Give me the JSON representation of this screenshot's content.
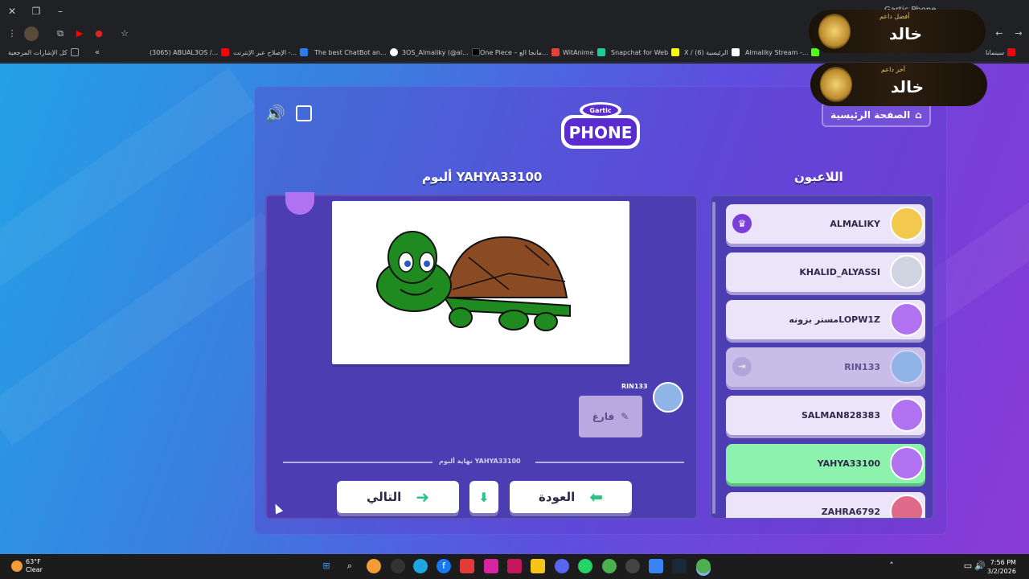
{
  "browser": {
    "tab_title": "Gartic Phone",
    "bookmarks": [
      {
        "label": "كل الإشارات المرجعية",
        "color": "#9aa0a6"
      },
      {
        "label": "(3065) ABUAL3OS /...",
        "color": "#ff0000"
      },
      {
        "label": "الإصلاح عبر الإنترنت -...",
        "color": "#2b7de9"
      },
      {
        "label": "The best ChatBot an...",
        "color": "#ffffff"
      },
      {
        "label": "3OS_Almaliky (@al...",
        "color": "#000000"
      },
      {
        "label": "One Piece – مانجا الع...",
        "color": "#e34234"
      },
      {
        "label": "WitAnime",
        "color": "#20c997"
      },
      {
        "label": "Snapchat for Web",
        "color": "#fffc00"
      },
      {
        "label": "X / الرئيسية (6)",
        "color": "#ffffff"
      },
      {
        "label": "Almaliky Stream -...",
        "color": "#53fc18"
      },
      {
        "label": "سينمانا",
        "color": "#e50914"
      }
    ]
  },
  "game": {
    "home_label": "الصفحة الرئيسية",
    "album_title": "ألبوم YAHYA33100",
    "players_title": "اللاعبون",
    "post_author": "RIN133",
    "bubble_text": "فارغ",
    "end_label": "نهاية ألبوم YAHYA33100",
    "next_label": "التالي",
    "back_label": "العودة",
    "logo_top": "Gartic",
    "logo_bottom": "PHONE",
    "players": [
      {
        "name": "ALMALIKY",
        "state": "host",
        "avatar_color": "#f2c94c"
      },
      {
        "name": "KHALID_ALYASSI",
        "state": "normal",
        "avatar_color": "#cfd4e0"
      },
      {
        "name": "مستر بزونهLOPW1Z",
        "state": "normal",
        "avatar_color": "#b072f0"
      },
      {
        "name": "RIN133",
        "state": "away",
        "avatar_color": "#8fb5e8"
      },
      {
        "name": "SALMAN828383",
        "state": "normal",
        "avatar_color": "#b072f0"
      },
      {
        "name": "YAHYA33100",
        "state": "me",
        "avatar_color": "#b072f0"
      },
      {
        "name": "ZAHRA6792",
        "state": "normal",
        "avatar_color": "#e06a8a"
      }
    ]
  },
  "overlays": [
    {
      "label": "أفضل داعم",
      "name": "خالد"
    },
    {
      "label": "آخر داعم",
      "name": "خالد"
    }
  ],
  "taskbar": {
    "temp": "63°F",
    "condition": "Clear",
    "time": "7:56 PM",
    "date": "3/2/2026"
  }
}
